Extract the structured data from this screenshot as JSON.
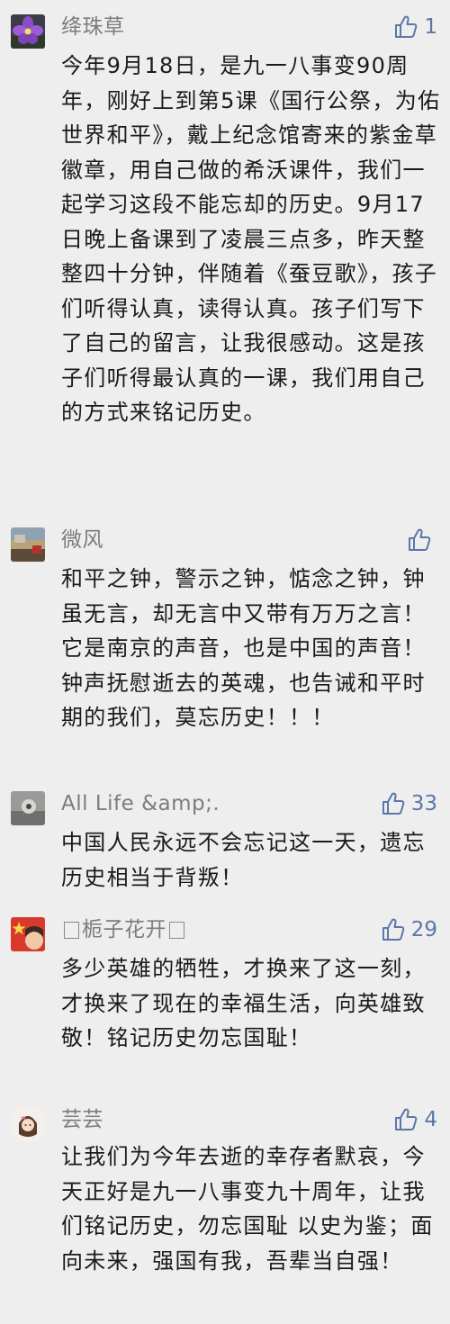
{
  "colors": {
    "background": "#eeeeee",
    "nickname": "#7c7c7c",
    "like": "#5b76a9",
    "text": "#1a1a1a"
  },
  "icons": {
    "like": "thumbs-up-icon"
  },
  "comments": [
    {
      "nickname": "绛珠草",
      "avatar": "purple-flower-avatar",
      "likes": "1",
      "text": "今年9月18日，是九一八事变90周年，刚好上到第5课《国行公祭，为佑世界和平》，戴上纪念馆寄来的紫金草徽章，用自己做的希沃课件，我们一起学习这段不能忘却的历史。9月17日晚上备课到了凌晨三点多，昨天整整四十分钟，伴随着《蚕豆歌》，孩子们听得认真，读得认真。孩子们写下了自己的留言，让我很感动。这是孩子们听得最认真的一课，我们用自己的方式来铭记历史。"
    },
    {
      "nickname": "微风",
      "avatar": "landscape-avatar",
      "likes": "",
      "text": "和平之钟，警示之钟，惦念之钟，钟虽无言，却无言中又带有万万之言！它是南京的声音，也是中国的声音！钟声抚慰逝去的英魂，也告诫和平时期的我们，莫忘历史！！！"
    },
    {
      "nickname": "All Life &amp;.",
      "avatar": "photo-avatar",
      "likes": "33",
      "text": "中国人民永远不会忘记这一天，遗忘历史相当于背叛！"
    },
    {
      "nickname": "栀子花开",
      "avatar": "flag-avatar",
      "likes": "29",
      "text": "多少英雄的牺牲，才换来了这一刻，才换来了现在的幸福生活，向英雄致敬！铭记历史勿忘国耻！"
    },
    {
      "nickname": "芸芸",
      "avatar": "cartoon-girl-avatar",
      "likes": "4",
      "text": "让我们为今年去逝的幸存者默哀，今天正好是九一八事变九十周年，让我们铭记历史，勿忘国耻 以史为鉴；面向未来，强国有我，吾辈当自强！"
    }
  ]
}
